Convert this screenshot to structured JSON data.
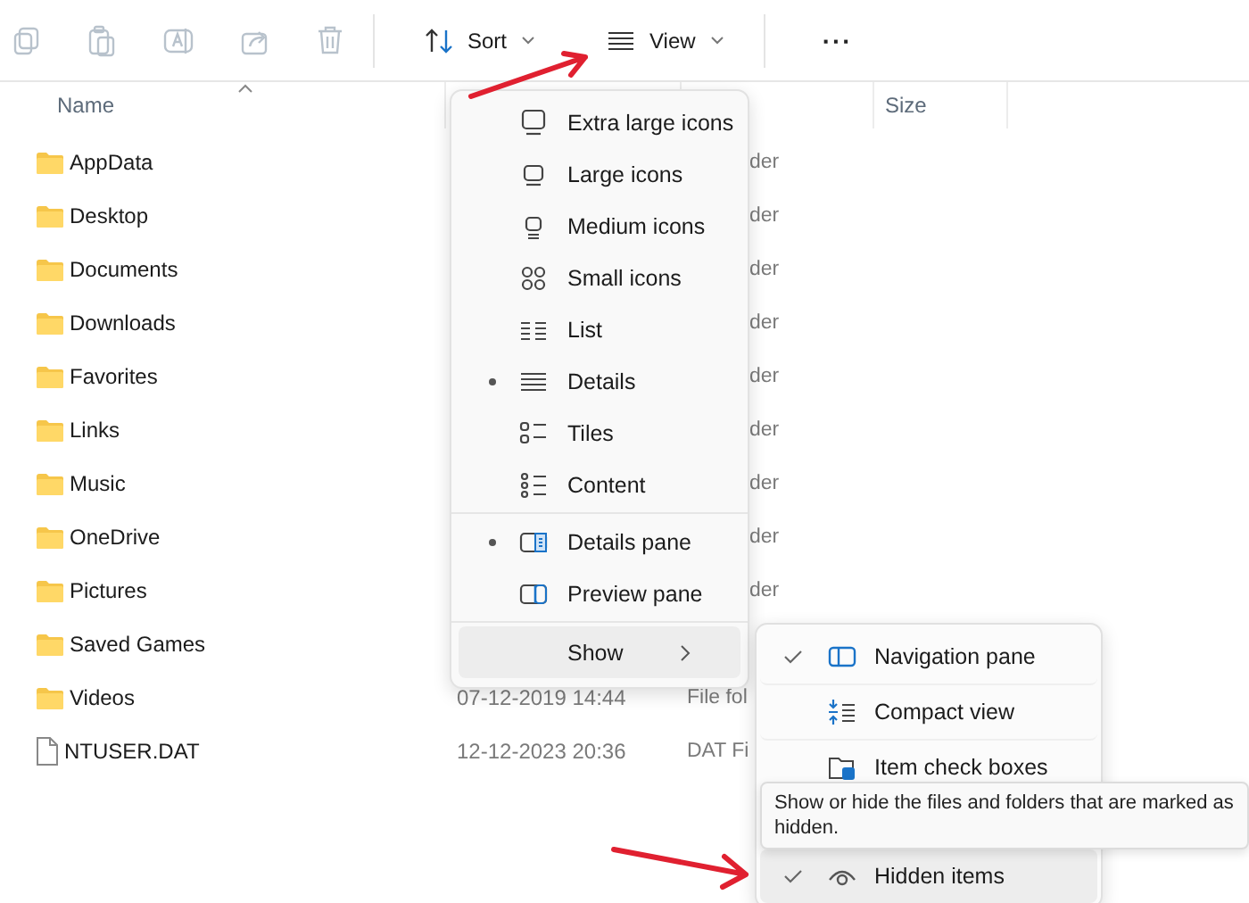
{
  "toolbar": {
    "sort": "Sort",
    "view": "View",
    "more": "···"
  },
  "columns": {
    "name": "Name",
    "size": "Size"
  },
  "rows": [
    {
      "name": "AppData",
      "kind": "folder",
      "type": "der"
    },
    {
      "name": "Desktop",
      "kind": "folder",
      "type": "der"
    },
    {
      "name": "Documents",
      "kind": "folder",
      "type": "der"
    },
    {
      "name": "Downloads",
      "kind": "folder",
      "type": "der"
    },
    {
      "name": "Favorites",
      "kind": "folder",
      "type": "der"
    },
    {
      "name": "Links",
      "kind": "folder",
      "type": "der"
    },
    {
      "name": "Music",
      "kind": "folder",
      "type": "der"
    },
    {
      "name": "OneDrive",
      "kind": "folder",
      "type": "der"
    },
    {
      "name": "Pictures",
      "kind": "folder",
      "type": "der"
    },
    {
      "name": "Saved Games",
      "kind": "folder"
    },
    {
      "name": "Videos",
      "kind": "folder",
      "date": "07-12-2019 14:44",
      "type": "File fol"
    },
    {
      "name": "NTUSER.DAT",
      "kind": "file",
      "date": "12-12-2023 20:36",
      "type": "DAT Fi"
    }
  ],
  "view_menu": {
    "layouts": [
      {
        "label": "Extra large icons",
        "selected": false
      },
      {
        "label": "Large icons",
        "selected": false
      },
      {
        "label": "Medium icons",
        "selected": false
      },
      {
        "label": "Small icons",
        "selected": false
      },
      {
        "label": "List",
        "selected": false
      },
      {
        "label": "Details",
        "selected": true
      },
      {
        "label": "Tiles",
        "selected": false
      },
      {
        "label": "Content",
        "selected": false
      }
    ],
    "panes": [
      {
        "label": "Details pane",
        "selected": true
      },
      {
        "label": "Preview pane",
        "selected": false
      }
    ],
    "show": {
      "label": "Show",
      "highlighted": true
    }
  },
  "show_menu": [
    {
      "label": "Navigation pane",
      "checked": true,
      "highlighted": false
    },
    {
      "label": "Compact view",
      "checked": false,
      "highlighted": false
    },
    {
      "label": "Item check boxes",
      "checked": false,
      "highlighted": false
    },
    {
      "label": "Hidden items",
      "checked": true,
      "highlighted": true
    }
  ],
  "tooltip": "Show or hide the files and folders that are marked as hidden."
}
